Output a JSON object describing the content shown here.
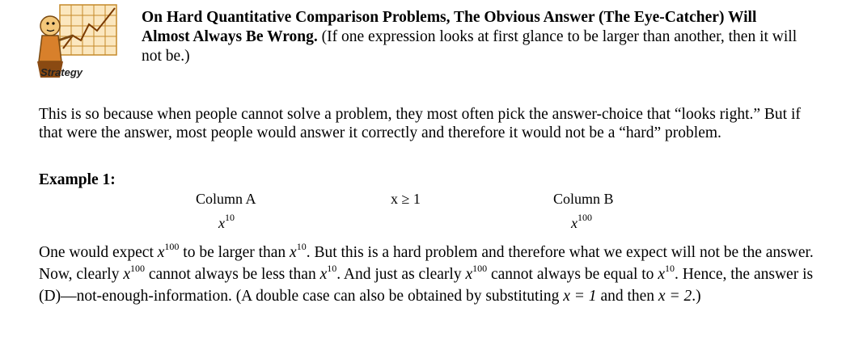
{
  "logo": {
    "label": "Strategy"
  },
  "heading": {
    "bold": "On Hard Quantitative Comparison Problems, The Obvious Answer (The Eye-Catcher) Will Almost Always Be Wrong.",
    "normal": "(If one expression looks at first glance to be larger than another, then it will not be.)"
  },
  "intro": "This is so because when people cannot solve a problem, they most often pick the answer-choice that “looks right.” But if that were the answer, most people would answer it correctly and therefore it would not be a “hard” problem.",
  "example": {
    "title": "Example 1:",
    "colA_label": "Column A",
    "condition": "x ≥ 1",
    "colB_label": "Column B",
    "var": "x",
    "colA_exp": "10",
    "colB_exp": "100"
  },
  "explanation": {
    "p1": "One would expect ",
    "p2": " to be larger than ",
    "p3": ". But this is a hard problem and therefore what we expect will not be the answer. Now, clearly ",
    "p4": " cannot always be less than ",
    "p5": ". And just as clearly ",
    "p6": " cannot always be equal to ",
    "p7": ". Hence, the answer is (D)—not-enough-information. (A double case can also be obtained by substituting ",
    "eq1": "x = 1",
    "p8": " and then ",
    "eq2": "x = 2",
    "p9": ".)"
  }
}
